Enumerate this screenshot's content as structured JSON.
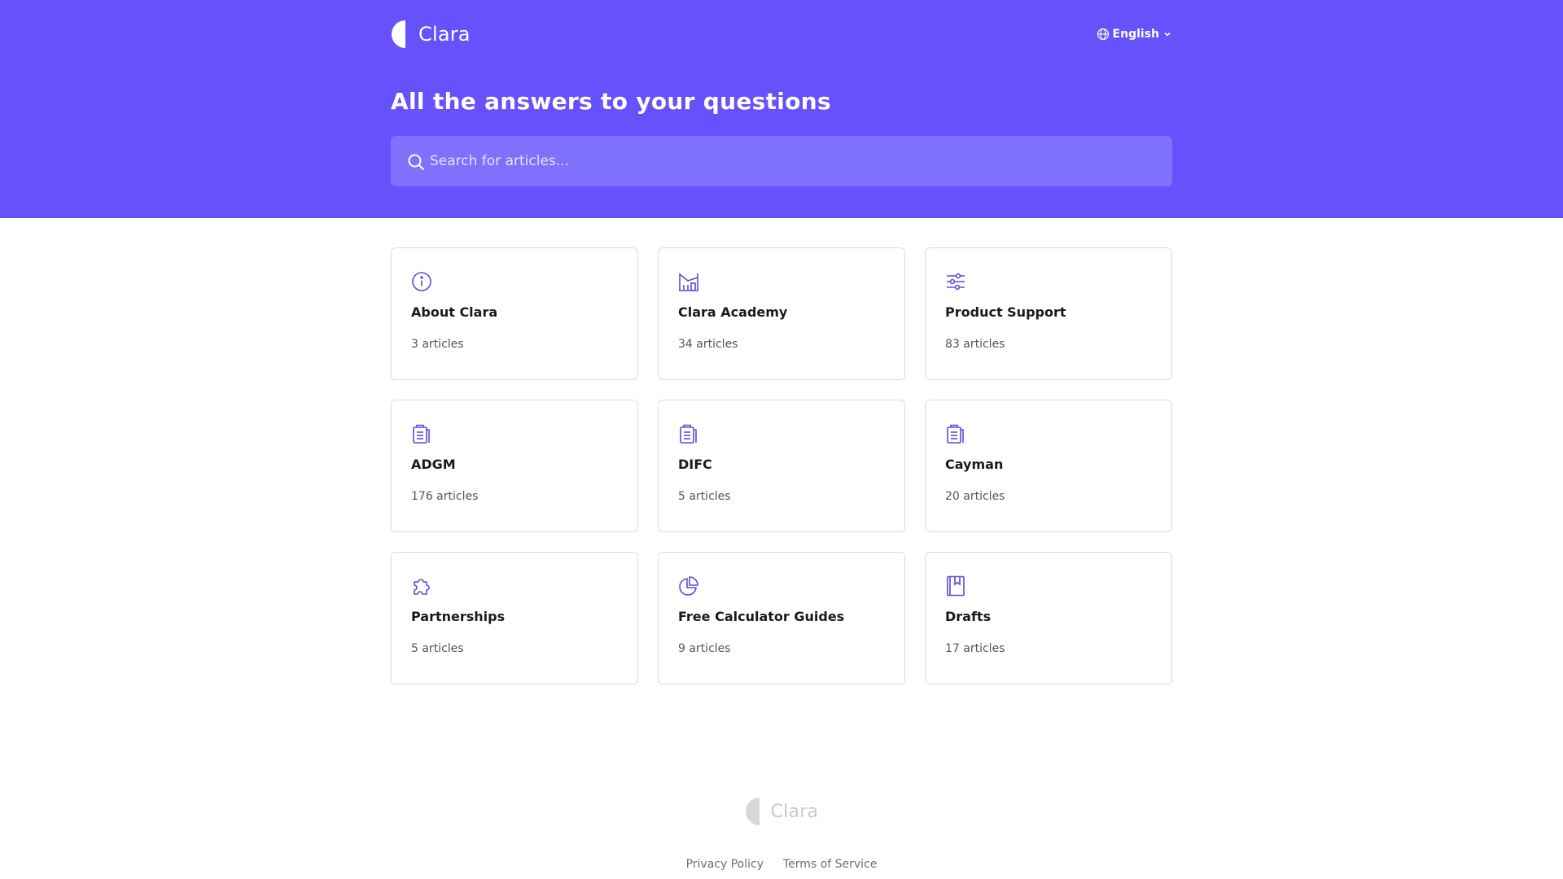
{
  "brand": {
    "name": "Clara",
    "color": "#6651fd"
  },
  "header": {
    "language": "English"
  },
  "hero": {
    "title": "All the answers to your questions"
  },
  "search": {
    "placeholder": "Search for articles..."
  },
  "collections": [
    {
      "icon": "info-icon",
      "title": "About Clara",
      "count": "3 articles"
    },
    {
      "icon": "academy-building-icon",
      "title": "Clara Academy",
      "count": "34 articles"
    },
    {
      "icon": "sliders-icon",
      "title": "Product Support",
      "count": "83 articles"
    },
    {
      "icon": "clipboard-icon",
      "title": "ADGM",
      "count": "176 articles"
    },
    {
      "icon": "clipboard-icon",
      "title": "DIFC",
      "count": "5 articles"
    },
    {
      "icon": "clipboard-icon",
      "title": "Cayman",
      "count": "20 articles"
    },
    {
      "icon": "puzzle-icon",
      "title": "Partnerships",
      "count": "5 articles"
    },
    {
      "icon": "pie-chart-icon",
      "title": "Free Calculator Guides",
      "count": "9 articles"
    },
    {
      "icon": "bookmark-book-icon",
      "title": "Drafts",
      "count": "17 articles"
    }
  ],
  "footer": {
    "brand": "Clara",
    "links": [
      "Privacy Policy",
      "Terms of Service"
    ]
  }
}
